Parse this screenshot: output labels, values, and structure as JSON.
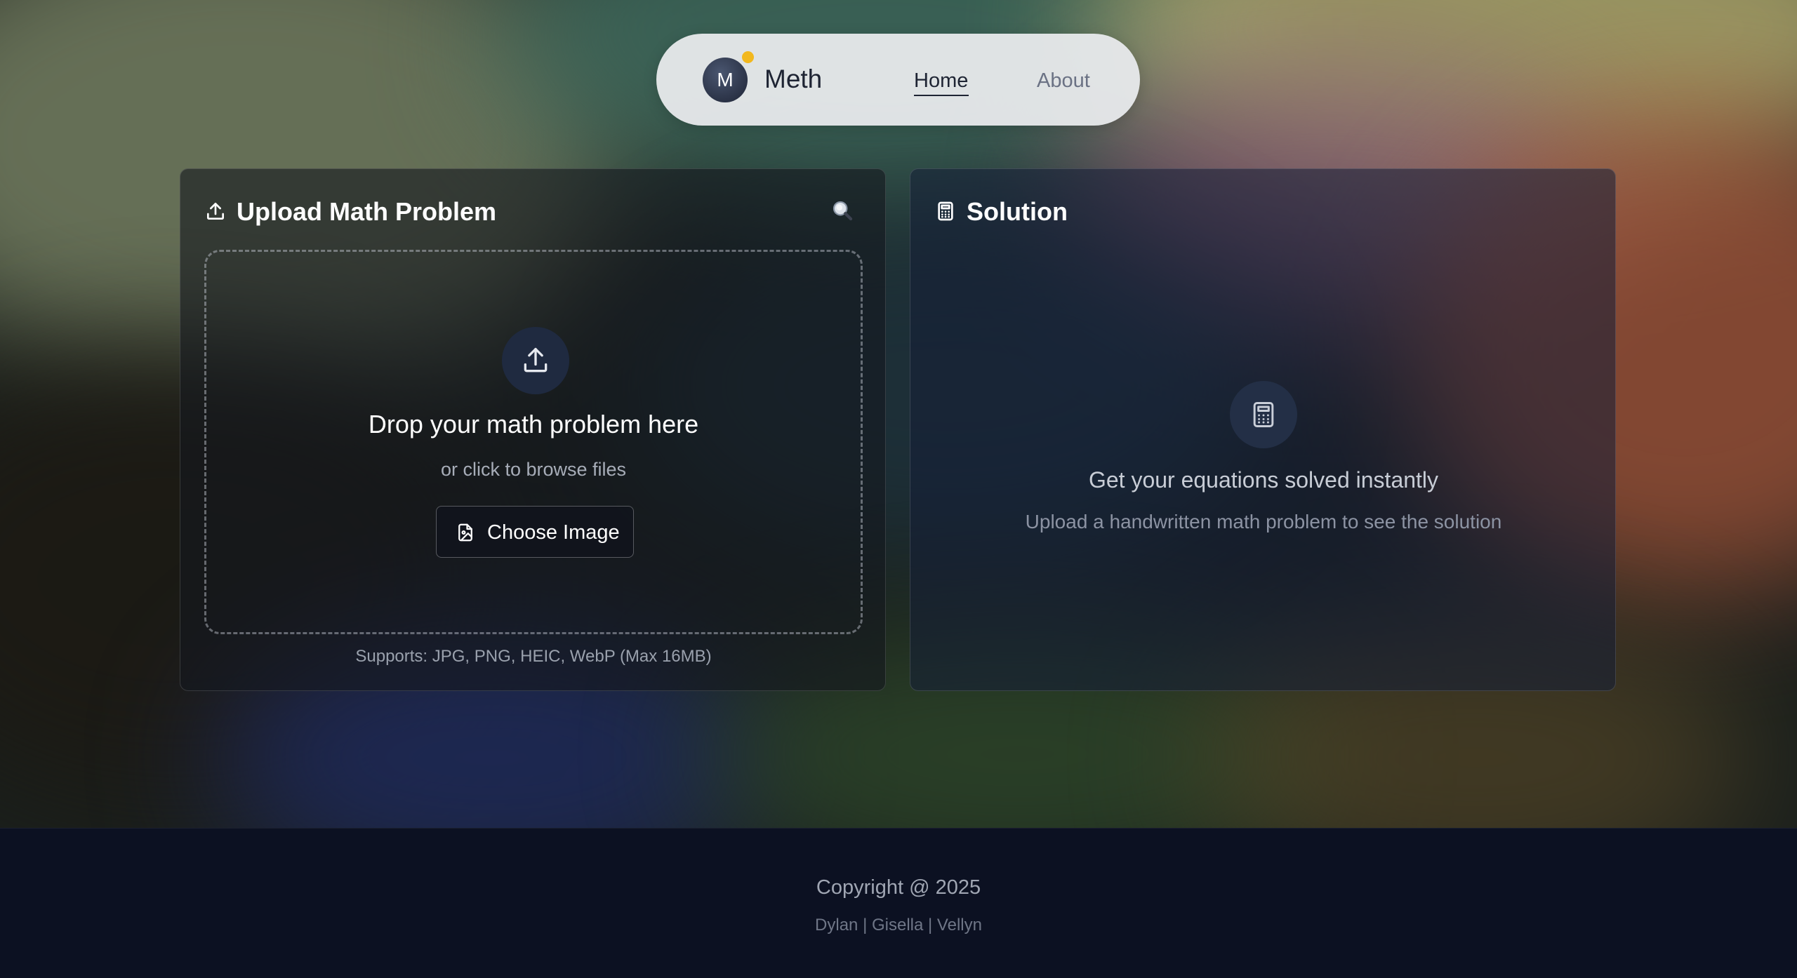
{
  "nav": {
    "avatar_letter": "M",
    "brand": "Meth",
    "links": [
      {
        "label": "Home",
        "active": true
      },
      {
        "label": "About",
        "active": false
      }
    ]
  },
  "upload_panel": {
    "title": "Upload Math Problem",
    "title_icon": "upload-icon",
    "action_icon": "magnifier-icon",
    "dropzone": {
      "icon": "upload-icon",
      "title": "Drop your math problem here",
      "subtitle": "or click to browse files",
      "button_label": "Choose Image",
      "button_icon": "image-file-icon"
    },
    "supports_text": "Supports: JPG, PNG, HEIC, WebP (Max 16MB)"
  },
  "solution_panel": {
    "title": "Solution",
    "title_icon": "calculator-icon",
    "placeholder": {
      "icon": "calculator-icon",
      "title": "Get your equations solved instantly",
      "subtitle": "Upload a handwritten math problem to see the solution"
    }
  },
  "footer": {
    "copyright": "Copyright @ 2025",
    "credits": "Dylan | Gisella | Vellyn"
  },
  "colors": {
    "accent_dot": "#f2b81e",
    "footer_bg": "#0c1122",
    "nav_bg": "#e8eaec"
  }
}
